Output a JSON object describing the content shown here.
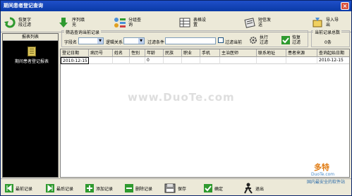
{
  "window": {
    "title": "期间患者登记查询"
  },
  "toolbar": [
    {
      "label": "恢复字段过滤",
      "icon": "restore-icon",
      "color": "#2f9a2f"
    },
    {
      "label": "序列填充",
      "icon": "fill-down-icon",
      "color": "#2f9a2f"
    },
    {
      "label": "分组查询",
      "icon": "group-query-icon",
      "color": "#4a90d9"
    },
    {
      "label": "表格设置",
      "icon": "table-settings-icon",
      "color": "#6a6a6a"
    },
    {
      "label": "短信发送",
      "icon": "sms-send-icon",
      "color": "#6a6a6a"
    },
    {
      "label": "导入导出",
      "icon": "import-export-icon",
      "color": "#6a6a6a"
    }
  ],
  "sidebar": {
    "header": "报表列表",
    "items": [
      {
        "label": "期间患者登记报表"
      }
    ]
  },
  "filter": {
    "legend": "筛选查询当前记录",
    "field_label": "字段名",
    "relation_label": "逻辑关系",
    "condition_label": "过滤条件",
    "filter_current_label": "过滤当前",
    "execute_label": "执行过滤",
    "restore_label": "恢复过滤"
  },
  "record_count": {
    "legend": "当前记录总数",
    "value": "0条"
  },
  "grid": {
    "columns": [
      "登记日期",
      "病历号",
      "姓名",
      "性别",
      "年龄",
      "民族",
      "职业",
      "手机",
      "主治医师",
      "联系地址",
      "患者来源",
      "查询起始日期"
    ],
    "rows": [
      [
        "2010-12-15",
        "",
        "",
        "",
        "0",
        "",
        "",
        "",
        "",
        "",
        "",
        "2010-12-15"
      ]
    ]
  },
  "watermark": "www.DuoTe.com",
  "bottom_buttons": [
    {
      "label": "最前记录",
      "icon": "first-record-icon"
    },
    {
      "label": "最后记录",
      "icon": "last-record-icon"
    },
    {
      "label": "添加记录",
      "icon": "add-record-icon"
    },
    {
      "label": "删除记录",
      "icon": "delete-record-icon"
    },
    {
      "label": "保存",
      "icon": "save-icon"
    },
    {
      "label": "确定",
      "icon": "confirm-icon"
    },
    {
      "label": "退出",
      "icon": "exit-icon"
    }
  ],
  "logo": {
    "line1": "多特",
    "line2": "DuoTe.com",
    "line3": "国内最安全的软件站"
  }
}
